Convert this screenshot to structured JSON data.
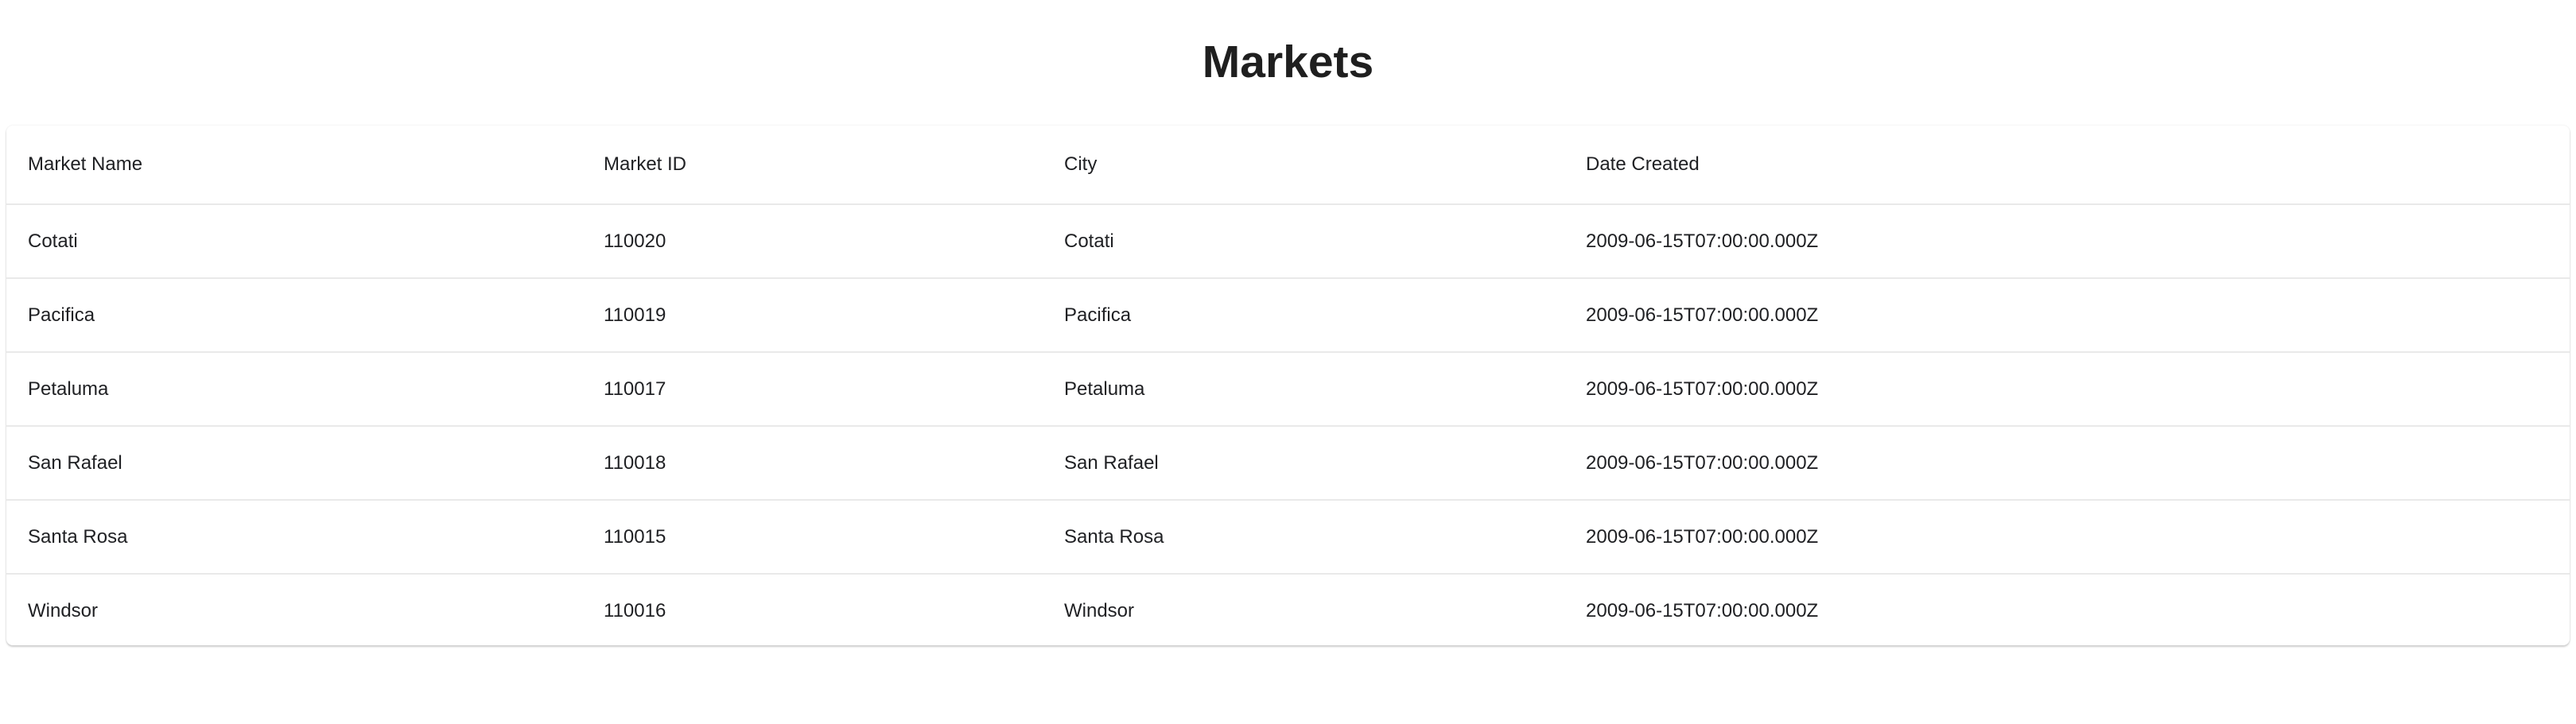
{
  "page": {
    "title": "Markets"
  },
  "table": {
    "columns": [
      "Market Name",
      "Market ID",
      "City",
      "Date Created"
    ],
    "rows": [
      [
        "Cotati",
        "110020",
        "Cotati",
        "2009-06-15T07:00:00.000Z"
      ],
      [
        "Pacifica",
        "110019",
        "Pacifica",
        "2009-06-15T07:00:00.000Z"
      ],
      [
        "Petaluma",
        "110017",
        "Petaluma",
        "2009-06-15T07:00:00.000Z"
      ],
      [
        "San Rafael",
        "110018",
        "San Rafael",
        "2009-06-15T07:00:00.000Z"
      ],
      [
        "Santa Rosa",
        "110015",
        "Santa Rosa",
        "2009-06-15T07:00:00.000Z"
      ],
      [
        "Windsor",
        "110016",
        "Windsor",
        "2009-06-15T07:00:00.000Z"
      ]
    ]
  }
}
